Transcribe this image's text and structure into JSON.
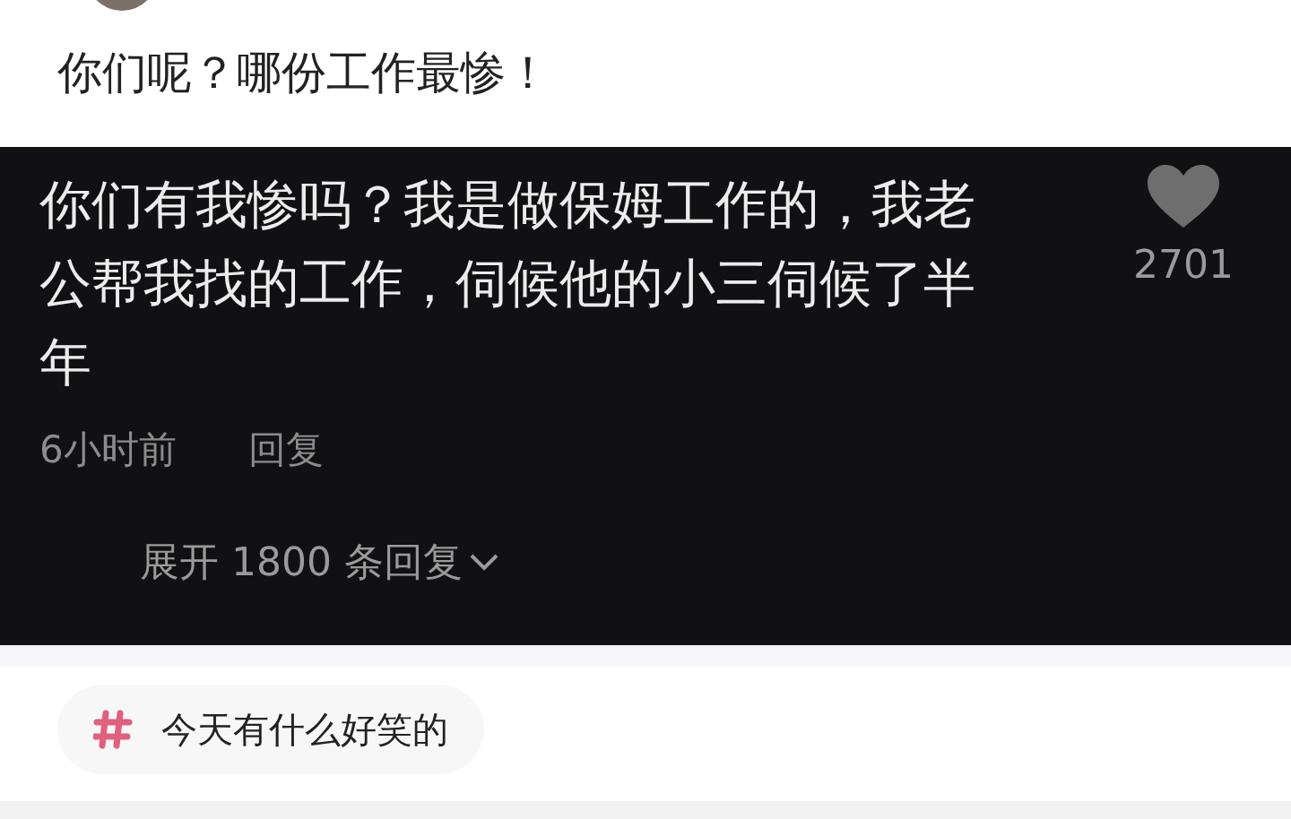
{
  "post": {
    "text": "你们呢？哪份工作最惨！"
  },
  "comment": {
    "text": "你们有我惨吗？我是做保姆工作的，我老公帮我找的工作，伺候他的小三伺候了半年",
    "likes": "2701",
    "time": "6小时前",
    "reply": "回复",
    "expand": "展开 1800 条回复"
  },
  "topic": {
    "label": "今天有什么好笑的"
  }
}
